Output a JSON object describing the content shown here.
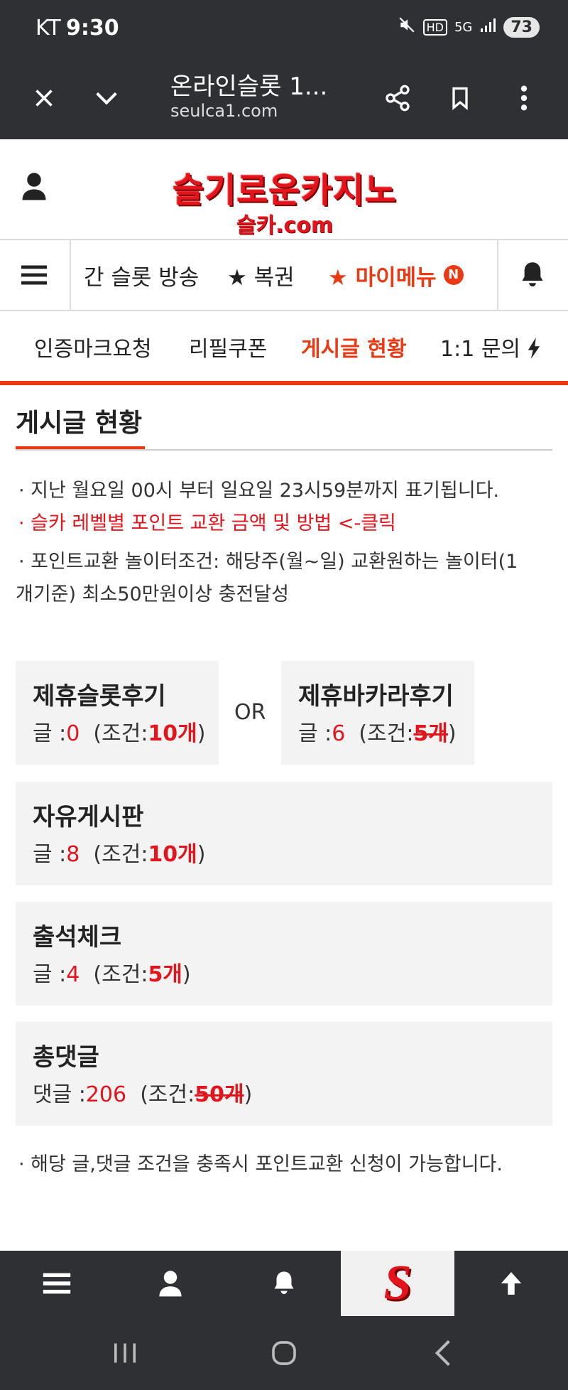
{
  "status_bar": {
    "carrier": "KT",
    "time": "9:30",
    "network_label": "5G",
    "battery": "73"
  },
  "browser": {
    "page_title": "온라인슬롯 1...",
    "url": "seulca1.com"
  },
  "site": {
    "logo_main": "슬기로운카지노",
    "logo_sub": "슬카.com"
  },
  "main_nav": {
    "items": [
      {
        "label": "간 슬롯 방송"
      },
      {
        "label": "★ 복권"
      },
      {
        "label": "★ 마이메뉴",
        "badge": "N"
      }
    ]
  },
  "sub_nav": {
    "items": [
      {
        "label": "인증마크요청"
      },
      {
        "label": "리필쿠폰"
      },
      {
        "label": "게시글 현황"
      },
      {
        "label": "1:1 문의"
      }
    ]
  },
  "page": {
    "title": "게시글 현황",
    "notes": [
      "· 지난 월요일 00시 부터 일요일 23시59분까지 표기됩니다.",
      "· 슬카 레벨별 포인트 교환 금액 및 방법 <-클릭",
      "· 포인트교환 놀이터조건: 해당주(월~일) 교환원하는 놀이터(1",
      "개기준) 최소50만원이상 충전달성"
    ],
    "or_label": "OR",
    "footer_note": "· 해당 글,댓글 조건을 충족시 포인트교환 신청이 가능합니다."
  },
  "boards": [
    {
      "title": "제휴슬롯후기",
      "count_label": "글 :",
      "count": "0",
      "cond_prefix": "(조건:",
      "cond_value": "10개",
      "cond_suffix": ")"
    },
    {
      "title": "제휴바카라후기",
      "count_label": "글 :",
      "count": "6",
      "cond_prefix": "(조건:",
      "cond_value": "5개",
      "cond_suffix": ")"
    },
    {
      "title": "자유게시판",
      "count_label": "글 :",
      "count": "8",
      "cond_prefix": "(조건:",
      "cond_value": "10개",
      "cond_suffix": ")"
    },
    {
      "title": "출석체크",
      "count_label": "글 :",
      "count": "4",
      "cond_prefix": "(조건:",
      "cond_value": "5개",
      "cond_suffix": ")"
    },
    {
      "title": "총댓글",
      "count_label": "댓글 :",
      "count": "206",
      "cond_prefix": "(조건:",
      "cond_value": "50개",
      "cond_suffix": ")"
    }
  ],
  "bottom_nav": {
    "logo_letter": "S"
  },
  "colors": {
    "accent": "#ea3a14",
    "brand_red": "#e3141b",
    "dark_bar": "#2f3033",
    "card_bg": "#f3f3f3"
  },
  "icons": [
    "close-icon",
    "chevron-down-icon",
    "share-icon",
    "bookmark-icon",
    "more-vert-icon",
    "user-icon",
    "hamburger-icon",
    "bell-icon",
    "lightning-icon",
    "arrow-up-icon",
    "android-recents-icon",
    "android-home-icon",
    "android-back-icon"
  ]
}
